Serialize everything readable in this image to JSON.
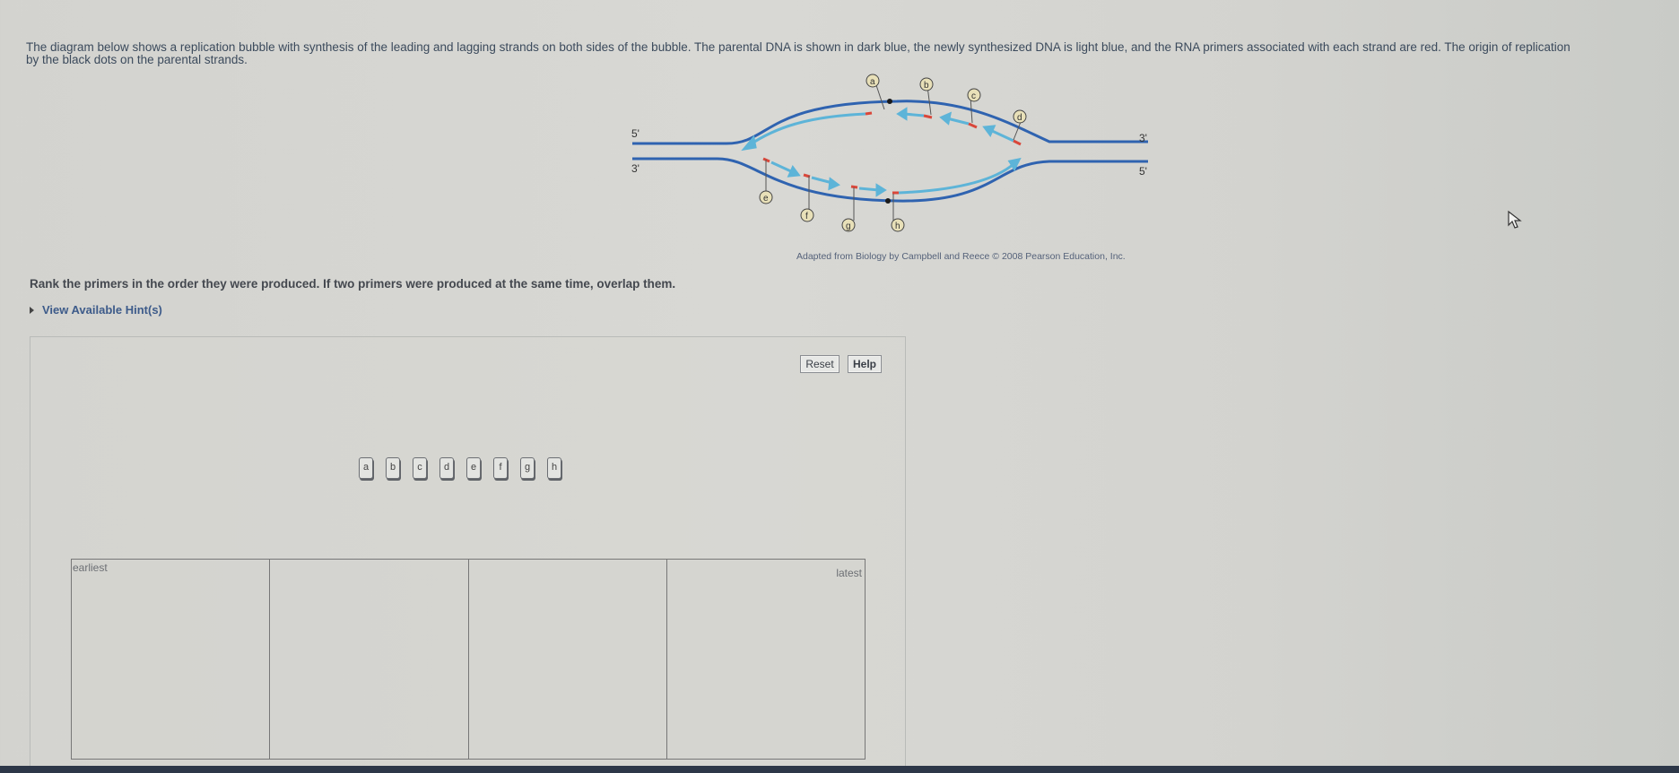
{
  "intro": {
    "line1": "The diagram below shows a replication bubble with synthesis of the leading and lagging strands on both sides of the bubble. The parental DNA is shown in dark blue, the newly synthesized DNA is light blue, and the RNA primers associated with each strand are red. The origin of replication",
    "line2": "by the black dots on the parental strands."
  },
  "diagram": {
    "labels": {
      "top_left_end": "5'",
      "top_right_end": "3'",
      "bottom_left_end": "3'",
      "bottom_right_end": "5'"
    },
    "primer_labels": [
      "a",
      "b",
      "c",
      "d",
      "e",
      "f",
      "g",
      "h"
    ],
    "colors": {
      "parental_dna": "#2f63b0",
      "new_dna": "#5db4d8",
      "rna_primer": "#d9473a",
      "origin_dot": "#1a1a1a"
    }
  },
  "credit": "Adapted from Biology by Campbell and Reece © 2008 Pearson Education, Inc.",
  "instruction": "Rank the primers in the order they were produced. If two primers were produced at the same time, overlap them.",
  "hint_toggle": "View Available Hint(s)",
  "buttons": {
    "reset": "Reset",
    "help": "Help"
  },
  "chips": [
    "a",
    "b",
    "c",
    "d",
    "e",
    "f",
    "g",
    "h"
  ],
  "ranking": {
    "earliest_label": "earliest",
    "latest_label": "latest"
  }
}
